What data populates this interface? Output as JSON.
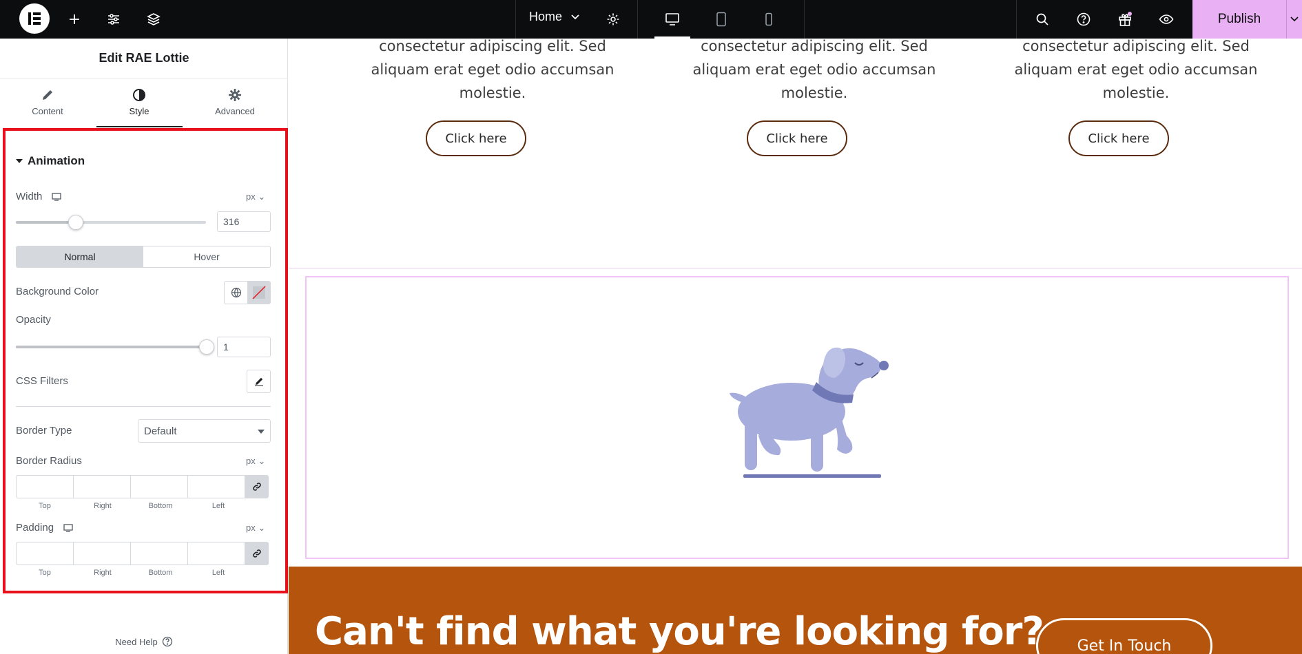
{
  "topbar": {
    "page_name": "Home",
    "publish_label": "Publish",
    "accent_color": "#e9b0f3",
    "icons": [
      "elementor-logo-icon",
      "add-icon",
      "settings-sliders-icon",
      "layers-icon",
      "chevron-down-icon",
      "gear-icon",
      "desktop-icon",
      "tablet-icon",
      "mobile-icon",
      "search-icon",
      "help-icon",
      "gift-icon",
      "preview-eye-icon"
    ]
  },
  "panel": {
    "title": "Edit RAE Lottie",
    "tabs": [
      {
        "label": "Content",
        "icon": "pencil-icon"
      },
      {
        "label": "Style",
        "icon": "half-circle-icon",
        "active": true
      },
      {
        "label": "Advanced",
        "icon": "gear-icon"
      }
    ],
    "section_title": "Animation",
    "width": {
      "label": "Width",
      "unit": "px",
      "value": "316",
      "slider_fraction": 0.31
    },
    "state": {
      "normal": "Normal",
      "hover": "Hover",
      "active": "Normal"
    },
    "background_color_label": "Background Color",
    "opacity": {
      "label": "Opacity",
      "value": "1",
      "slider_fraction": 1.0
    },
    "css_filters_label": "CSS Filters",
    "border_type": {
      "label": "Border Type",
      "value": "Default"
    },
    "border_radius": {
      "label": "Border Radius",
      "unit": "px"
    },
    "padding": {
      "label": "Padding",
      "unit": "px"
    },
    "dim_labels": [
      "Top",
      "Right",
      "Bottom",
      "Left"
    ],
    "need_help": "Need Help",
    "highlight_color": "#e8111b"
  },
  "canvas": {
    "cards": [
      {
        "text": "consectetur adipiscing elit. Sed aliquam erat eget odio accumsan molestie.",
        "button": "Click here"
      },
      {
        "text": "consectetur adipiscing elit. Sed aliquam erat eget odio accumsan molestie.",
        "button": "Click here"
      },
      {
        "text": "consectetur adipiscing elit. Sed aliquam erat eget odio accumsan molestie.",
        "button": "Click here"
      }
    ],
    "cta_title": "Can't find what you're looking for?",
    "cta_button": "Get In Touch",
    "cta_color": "#b5540c",
    "lottie_illustration": "dog-walking-illustration"
  }
}
